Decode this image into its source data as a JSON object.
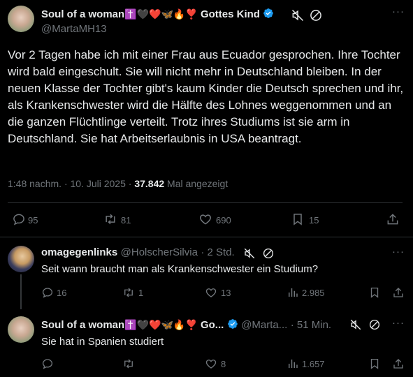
{
  "main_post": {
    "name": "Soul of a woman",
    "name_emojis": "✝️🖤❤️🦋🔥❣️",
    "name_suffix": "Gottes Kind",
    "handle": "@MartaMH13",
    "text": "Vor 2 Tagen habe ich mit einer Frau aus Ecuador gesprochen.  Ihre Tochter wird bald eingeschult.  Sie will nicht mehr in Deutschland bleiben.  In der neuen Klasse der Tochter gibt's kaum Kinder die Deutsch sprechen und ihr, als Krankenschwester wird die Hälfte des Lohnes weggenommen und an die ganzen Flüchtlinge verteilt.  Trotz ihres Studiums ist sie arm in Deutschland.  Sie hat Arbeitserlaubnis in USA beantragt.",
    "time": "1:48 nachm. · 10. Juli 2025 · ",
    "views": "37.842",
    "views_label": " Mal angezeigt",
    "replies": "95",
    "reposts": "81",
    "likes": "690",
    "bookmarks": "15"
  },
  "reply1": {
    "name": "omagegenlinks",
    "handle": "@HolscherSilvia",
    "time": "· 2 Std.",
    "text": "Seit wann braucht man als Krankenschwester ein Studium?",
    "replies": "16",
    "reposts": "1",
    "likes": "13",
    "views": "2.985"
  },
  "reply2": {
    "name": "Soul of a woman",
    "name_emojis": "✝️🖤❤️🦋🔥❣️",
    "name_suffix": "Go...",
    "handle": "@Marta...",
    "time": "· 51 Min.",
    "text": "Sie hat in Spanien studiert",
    "likes": "8",
    "views": "1.657"
  },
  "colors": {
    "background": "#000000",
    "text": "#e7e9ea",
    "muted": "#71767b",
    "verified": "#1d9bf0",
    "divider": "#2f3336"
  }
}
